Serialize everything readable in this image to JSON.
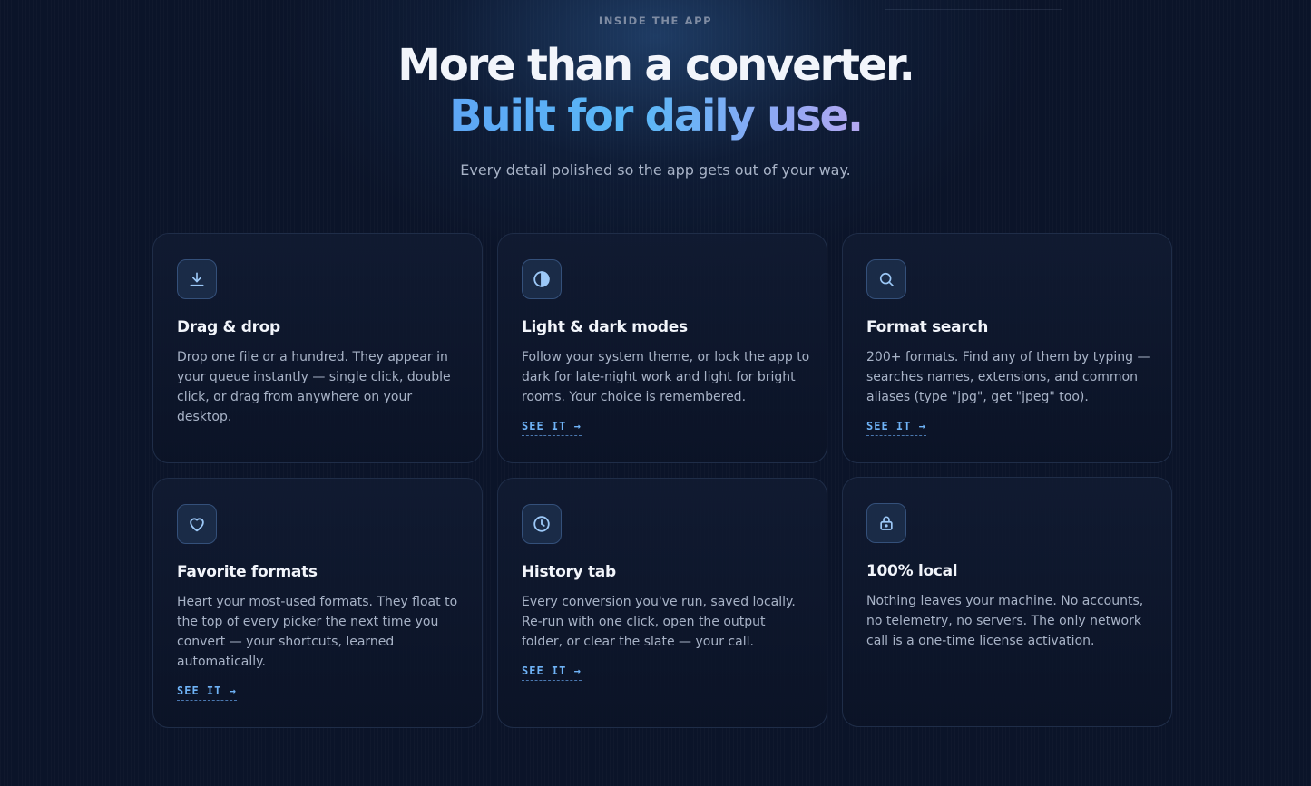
{
  "header": {
    "eyebrow": "INSIDE THE APP",
    "title_line1": "More than a converter.",
    "title_line2": "Built for daily use.",
    "subtitle": "Every detail polished so the app gets out of your way."
  },
  "colors": {
    "background": "#0b1429",
    "accent": "#6fb3f7",
    "gradient_start": "#5ea6f5",
    "gradient_end": "#b4a7f0",
    "card_border": "#1f2d48"
  },
  "cards": [
    {
      "icon": "download-icon",
      "title": "Drag & drop",
      "description": "Drop one file or a hundred. They appear in your queue instantly — single click, double click, or drag from anywhere on your desktop.",
      "link": ""
    },
    {
      "icon": "contrast-icon",
      "title": "Light & dark modes",
      "description": "Follow your system theme, or lock the app to dark for late-night work and light for bright rooms. Your choice is remembered.",
      "link": "SEE IT →"
    },
    {
      "icon": "search-icon",
      "title": "Format search",
      "description": "200+ formats. Find any of them by typing — searches names, extensions, and common aliases (type \"jpg\", get \"jpeg\" too).",
      "link": "SEE IT →"
    },
    {
      "icon": "heart-icon",
      "title": "Favorite formats",
      "description": "Heart your most-used formats. They float to the top of every picker the next time you convert — your shortcuts, learned automatically.",
      "link": "SEE IT →"
    },
    {
      "icon": "clock-icon",
      "title": "History tab",
      "description": "Every conversion you've run, saved locally. Re-run with one click, open the output folder, or clear the slate — your call.",
      "link": "SEE IT →"
    },
    {
      "icon": "lock-icon",
      "title": "100% local",
      "description": "Nothing leaves your machine. No accounts, no telemetry, no servers. The only network call is a one-time license activation.",
      "link": ""
    }
  ]
}
